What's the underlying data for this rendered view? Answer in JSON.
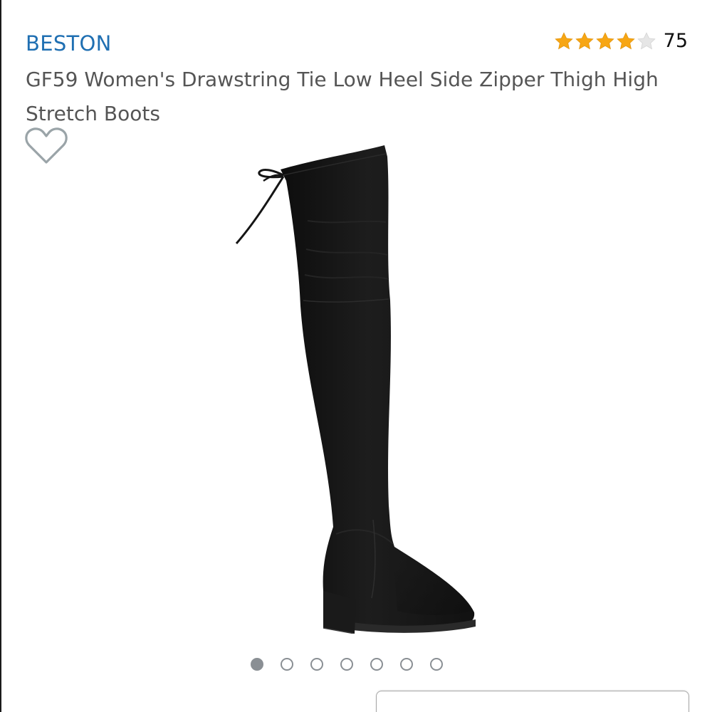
{
  "product": {
    "brand": "BESTON",
    "title": "GF59 Women's Drawstring Tie Low Heel Side Zipper Thigh High Stretch Boots",
    "rating": {
      "stars": 4,
      "max_stars": 5,
      "count": "75"
    }
  },
  "icons": {
    "wishlist": "heart-outline-icon",
    "star_filled": "star-filled-icon",
    "star_empty": "star-empty-icon"
  },
  "carousel": {
    "total": 7,
    "active_index": 0
  },
  "colors": {
    "brand_link": "#1f6fb2",
    "star": "#f7a614",
    "star_empty": "#dddddd",
    "dot": "#8a8f94"
  }
}
